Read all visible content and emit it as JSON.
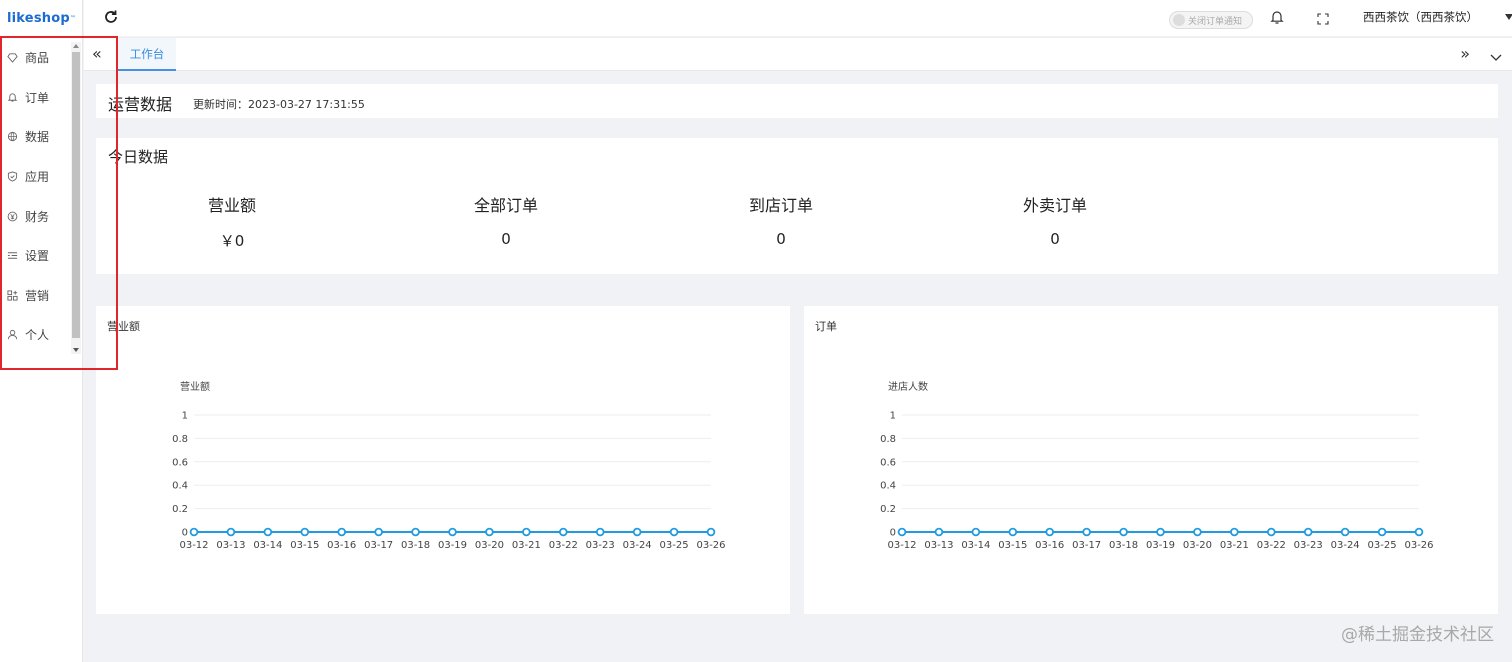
{
  "app": {
    "logo": "likeshop",
    "logo_tm": "™"
  },
  "sidebar": {
    "items": [
      {
        "label": "商品",
        "icon": "diamond-icon"
      },
      {
        "label": "订单",
        "icon": "bell-icon"
      },
      {
        "label": "数据",
        "icon": "globe-icon"
      },
      {
        "label": "应用",
        "icon": "shield-icon"
      },
      {
        "label": "财务",
        "icon": "yen-icon"
      },
      {
        "label": "设置",
        "icon": "list-icon"
      },
      {
        "label": "营销",
        "icon": "grid-icon"
      },
      {
        "label": "个人",
        "icon": "user-icon"
      }
    ]
  },
  "header": {
    "notify_toggle": "关闭订单通知",
    "store_name": "西西茶饮（西西茶饮）"
  },
  "tabs": {
    "active": "工作台"
  },
  "ops": {
    "title": "运营数据",
    "update_label": "更新时间：2023-03-27 17:31:55"
  },
  "today": {
    "title": "今日数据",
    "stats": [
      {
        "label": "营业额",
        "value": "￥0"
      },
      {
        "label": "全部订单",
        "value": "0"
      },
      {
        "label": "到店订单",
        "value": "0"
      },
      {
        "label": "外卖订单",
        "value": "0"
      }
    ]
  },
  "watermark": "@稀土掘金技术社区",
  "chart_data": [
    {
      "type": "line",
      "card_title": "营业额",
      "title": "",
      "ylabel": "营业额",
      "categories": [
        "03-12",
        "03-13",
        "03-14",
        "03-15",
        "03-16",
        "03-17",
        "03-18",
        "03-19",
        "03-20",
        "03-21",
        "03-22",
        "03-23",
        "03-24",
        "03-25",
        "03-26"
      ],
      "values": [
        0,
        0,
        0,
        0,
        0,
        0,
        0,
        0,
        0,
        0,
        0,
        0,
        0,
        0,
        0
      ],
      "yticks": [
        "0",
        "0.2",
        "0.4",
        "0.6",
        "0.8",
        "1"
      ],
      "ylim": [
        0,
        1
      ],
      "color": "#1f9be0",
      "grid": true
    },
    {
      "type": "line",
      "card_title": "订单",
      "title": "",
      "ylabel": "进店人数",
      "categories": [
        "03-12",
        "03-13",
        "03-14",
        "03-15",
        "03-16",
        "03-17",
        "03-18",
        "03-19",
        "03-20",
        "03-21",
        "03-22",
        "03-23",
        "03-24",
        "03-25",
        "03-26"
      ],
      "values": [
        0,
        0,
        0,
        0,
        0,
        0,
        0,
        0,
        0,
        0,
        0,
        0,
        0,
        0,
        0
      ],
      "yticks": [
        "0",
        "0.2",
        "0.4",
        "0.6",
        "0.8",
        "1"
      ],
      "ylim": [
        0,
        1
      ],
      "color": "#1f9be0",
      "grid": true
    }
  ]
}
